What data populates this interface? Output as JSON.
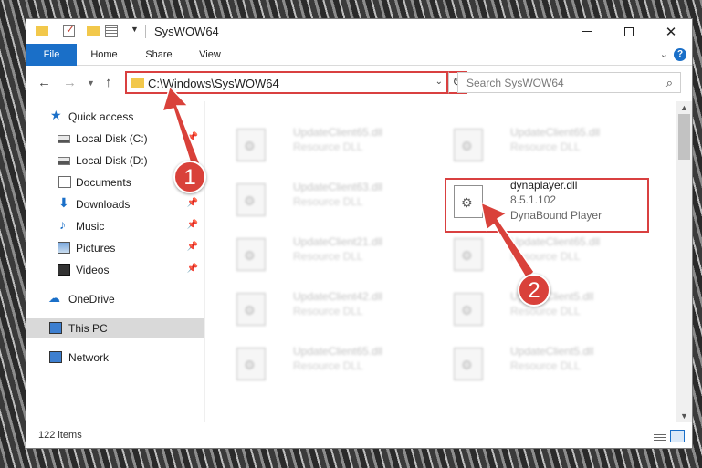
{
  "window": {
    "title": "SysWOW64"
  },
  "ribbon": {
    "tabs": [
      {
        "label": "File"
      },
      {
        "label": "Home"
      },
      {
        "label": "Share"
      },
      {
        "label": "View"
      }
    ],
    "help_label": "?"
  },
  "address": {
    "path": "C:\\Windows\\SysWOW64"
  },
  "search": {
    "placeholder": "Search SysWOW64"
  },
  "nav": {
    "items": [
      {
        "label": "Quick access",
        "icon": "star-icon",
        "pinned": false
      },
      {
        "label": "Local Disk (C:)",
        "icon": "drive-icon",
        "pinned": true
      },
      {
        "label": "Local Disk (D:)",
        "icon": "drive-icon",
        "pinned": true
      },
      {
        "label": "Documents",
        "icon": "documents-icon",
        "pinned": true
      },
      {
        "label": "Downloads",
        "icon": "downloads-icon",
        "pinned": true
      },
      {
        "label": "Music",
        "icon": "music-icon",
        "pinned": true
      },
      {
        "label": "Pictures",
        "icon": "pictures-icon",
        "pinned": true
      },
      {
        "label": "Videos",
        "icon": "videos-icon",
        "pinned": true
      },
      {
        "label": "OneDrive",
        "icon": "onedrive-icon",
        "pinned": false
      },
      {
        "label": "This PC",
        "icon": "this-pc-icon",
        "pinned": false,
        "selected": true
      },
      {
        "label": "Network",
        "icon": "network-icon",
        "pinned": false
      }
    ]
  },
  "files": [
    {
      "name": "UpdateClient65.dll",
      "desc": "Resource DLL"
    },
    {
      "name": "UpdateClient65.dll",
      "desc": "Resource DLL"
    },
    {
      "name": "UpdateClient63.dll",
      "desc": "Resource DLL"
    },
    {
      "name": "dynaplayer.dll",
      "version": "8.5.1.102",
      "desc": "DynaBound Player",
      "highlighted": true
    },
    {
      "name": "UpdateClient21.dll",
      "desc": "Resource DLL"
    },
    {
      "name": "UpdateClient65.dll",
      "desc": "Resource DLL"
    },
    {
      "name": "UpdateClient42.dll",
      "desc": "Resource DLL"
    },
    {
      "name": "UpdateClient5.dll",
      "desc": "Resource DLL"
    },
    {
      "name": "UpdateClient65.dll",
      "desc": "Resource DLL"
    },
    {
      "name": "UpdateClient5.dll",
      "desc": "Resource DLL"
    }
  ],
  "status": {
    "item_count": "122 items"
  },
  "annotations": {
    "callout_1": "1",
    "callout_2": "2",
    "color": "#d9413a"
  }
}
